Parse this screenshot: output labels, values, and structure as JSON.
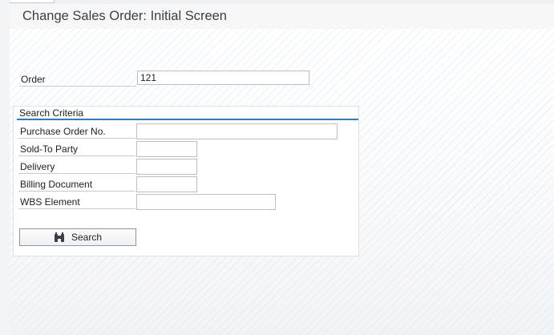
{
  "header": {
    "title": "Change Sales Order: Initial Screen"
  },
  "order": {
    "label": "Order",
    "value": "121"
  },
  "search_criteria": {
    "title": "Search Criteria",
    "fields": [
      {
        "label": "Purchase Order No.",
        "value": ""
      },
      {
        "label": "Sold-To Party",
        "value": ""
      },
      {
        "label": "Delivery",
        "value": ""
      },
      {
        "label": "Billing Document",
        "value": ""
      },
      {
        "label": "WBS Element",
        "value": ""
      }
    ],
    "search_button": {
      "label": "Search",
      "icon": "binoculars-icon"
    }
  },
  "colors": {
    "accent_line": "#2a7ec3",
    "title_text": "#3b3f44",
    "field_border": "#b9bec4"
  }
}
